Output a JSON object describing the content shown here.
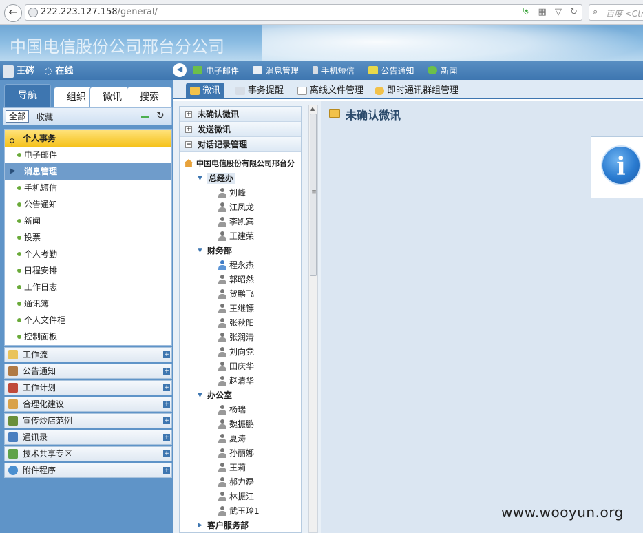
{
  "browser": {
    "url_host": "222.223.127.158",
    "url_path": "/general/",
    "search_placeholder": "百度 <Ctrl"
  },
  "banner": {
    "title": "中国电信股份公司邢台分公司"
  },
  "user": {
    "name": "王硶",
    "status": "在线"
  },
  "quick_links": [
    "电子邮件",
    "消息管理",
    "手机短信",
    "公告通知",
    "新闻"
  ],
  "side_tabs": [
    "导航",
    "组织",
    "微讯",
    "搜索"
  ],
  "side_sub": {
    "all": "全部",
    "fav": "收藏"
  },
  "menu": {
    "head": "个人事务",
    "items": [
      "电子邮件",
      "消息管理",
      "手机短信",
      "公告通知",
      "新闻",
      "投票",
      "个人考勤",
      "日程安排",
      "工作日志",
      "通讯簿",
      "个人文件柜",
      "控制面板"
    ],
    "active_index": 1
  },
  "groups": [
    "工作流",
    "公告通知",
    "工作计划",
    "合理化建议",
    "宣传炒店范例",
    "通讯录",
    "技术共享专区",
    "附件程序"
  ],
  "main_tabs": [
    "微讯",
    "事务提醒",
    "离线文件管理",
    "即时通讯群组管理"
  ],
  "tree": {
    "sections": [
      "未确认微讯",
      "发送微讯",
      "对话记录管理"
    ],
    "root": "中国电信股份有限公司邢台分",
    "depts": [
      {
        "name": "总经办",
        "people": [
          "刘峰",
          "江凤龙",
          "李凯宾",
          "王建荣"
        ]
      },
      {
        "name": "财务部",
        "people": [
          "程永杰",
          "郭昭然",
          "贺鹏飞",
          "王继镖",
          "张秋阳",
          "张润清",
          "刘向党",
          "田庆华",
          "赵清华"
        ]
      },
      {
        "name": "办公室",
        "people": [
          "杨瑞",
          "魏振鹏",
          "夏涛",
          "孙丽娜",
          "王莉",
          "郝力磊",
          "林振江",
          "武玉玲1"
        ]
      },
      {
        "name": "客户服务部",
        "people": []
      }
    ]
  },
  "content": {
    "title": "未确认微讯",
    "info_glyph": "i"
  },
  "watermark": "www.wooyun.org",
  "colors": {
    "accent": "#3e76b0",
    "highlight": "#f5c21b",
    "sidebar": "#5f94c8"
  }
}
